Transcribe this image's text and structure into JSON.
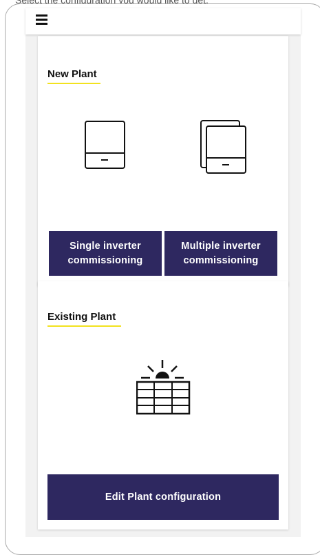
{
  "top_hint": "Select the configuration you would like to get.",
  "menu": {
    "icon": "hamburger-menu-icon"
  },
  "new_plant": {
    "title": "New Plant",
    "accent_color": "#f2e21e",
    "options": [
      {
        "label": "Single inverter commissioning",
        "icon": "single-inverter-icon"
      },
      {
        "label": "Multiple inverter commissioning",
        "icon": "multiple-inverter-icon"
      }
    ]
  },
  "existing_plant": {
    "title": "Existing Plant",
    "icon": "solar-panel-sun-icon",
    "button_label": "Edit Plant configuration"
  },
  "colors": {
    "button_bg": "#2e2860",
    "accent": "#f2e21e",
    "background": "#f2f2f2"
  }
}
